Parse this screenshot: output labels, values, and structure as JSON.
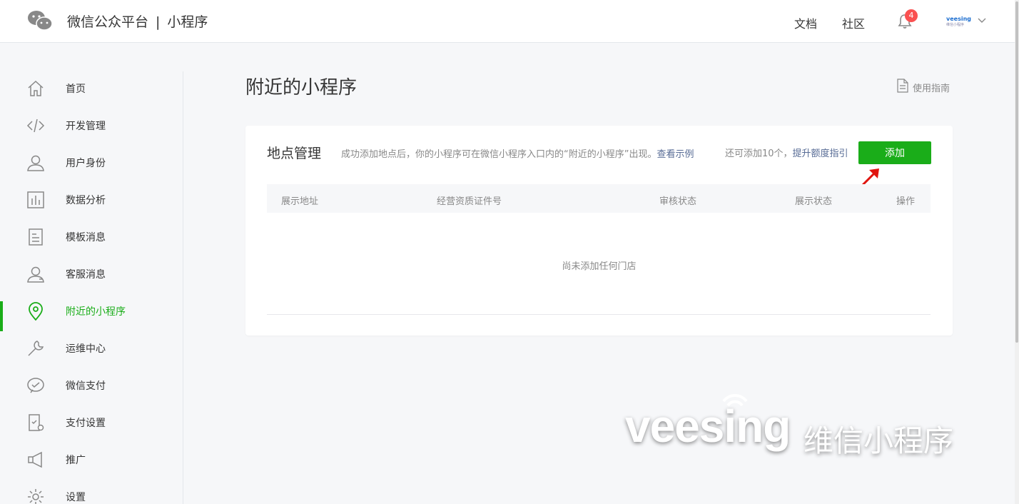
{
  "header": {
    "brand_main": "微信公众平台",
    "brand_sep": "|",
    "brand_sub": "小程序",
    "nav_docs": "文档",
    "nav_community": "社区",
    "notification_count": "4",
    "avatar_text": "veesing",
    "avatar_sub": "维信小程序"
  },
  "sidebar": {
    "items": [
      {
        "label": "首页",
        "icon": "home-icon"
      },
      {
        "label": "开发管理",
        "icon": "code-icon"
      },
      {
        "label": "用户身份",
        "icon": "user-icon"
      },
      {
        "label": "数据分析",
        "icon": "bar-chart-icon"
      },
      {
        "label": "模板消息",
        "icon": "document-icon"
      },
      {
        "label": "客服消息",
        "icon": "customer-service-icon"
      },
      {
        "label": "附近的小程序",
        "icon": "location-pin-icon",
        "active": true
      },
      {
        "label": "运维中心",
        "icon": "wrench-icon"
      },
      {
        "label": "微信支付",
        "icon": "wechat-pay-icon"
      },
      {
        "label": "支付设置",
        "icon": "payment-settings-icon"
      },
      {
        "label": "推广",
        "icon": "megaphone-icon"
      },
      {
        "label": "设置",
        "icon": "gear-icon"
      }
    ]
  },
  "main": {
    "title": "附近的小程序",
    "guide_label": "使用指南",
    "card": {
      "title": "地点管理",
      "desc": "成功添加地点后，你的小程序可在微信小程序入口内的“附近的小程序”出现。",
      "desc_link": "查看示例",
      "quota": "还可添加10个，",
      "quota_link": "提升额度指引",
      "add_label": "添加",
      "columns": [
        "展示地址",
        "经营资质证件号",
        "审核状态",
        "展示状态",
        "操作"
      ],
      "empty_text": "尚未添加任何门店"
    }
  },
  "watermark": {
    "text_en": "veesing",
    "text_cn": "维信小程序"
  },
  "colors": {
    "accent": "#1aad19",
    "link": "#576b95",
    "badge": "#fa5151",
    "arrow": "#e0140f"
  }
}
